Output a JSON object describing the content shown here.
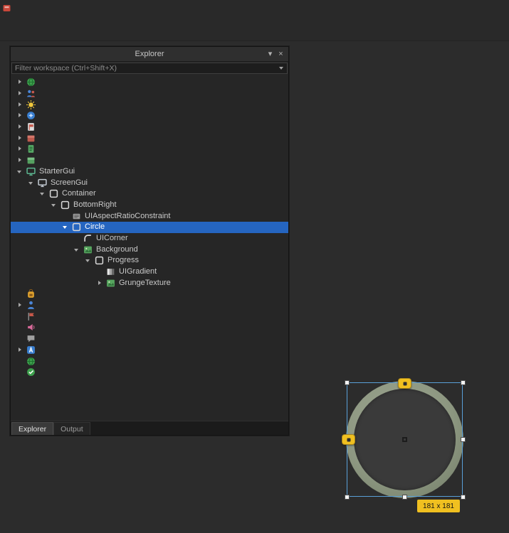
{
  "app": {
    "top_left_icon": "red-app-icon"
  },
  "explorer": {
    "title": "Explorer",
    "titlebar": {
      "chevron_glyph": "▾",
      "close_glyph": "×"
    },
    "filter_placeholder": "Filter workspace (Ctrl+Shift+X)",
    "tabs": [
      {
        "label": "Explorer",
        "active": true
      },
      {
        "label": "Output",
        "active": false
      }
    ],
    "tree": {
      "items": [
        {
          "label": "",
          "icon": "globe-icon",
          "level": 0,
          "state": "collapsed"
        },
        {
          "label": "",
          "icon": "people-icon",
          "level": 0,
          "state": "collapsed"
        },
        {
          "label": "",
          "icon": "sun-icon",
          "level": 0,
          "state": "collapsed"
        },
        {
          "label": "",
          "icon": "blue-sphere-icon",
          "level": 0,
          "state": "collapsed"
        },
        {
          "label": "",
          "icon": "document-flag-icon",
          "level": 0,
          "state": "collapsed"
        },
        {
          "label": "",
          "icon": "red-box-icon",
          "level": 0,
          "state": "collapsed"
        },
        {
          "label": "",
          "icon": "green-document-icon",
          "level": 0,
          "state": "collapsed"
        },
        {
          "label": "",
          "icon": "green-box-icon",
          "level": 0,
          "state": "collapsed"
        },
        {
          "label": "StarterGui",
          "icon": "monitor-icon",
          "level": 0,
          "state": "expanded"
        },
        {
          "label": "ScreenGui",
          "icon": "monitor-icon",
          "level": 1,
          "state": "expanded"
        },
        {
          "label": "Container",
          "icon": "frame-icon",
          "level": 2,
          "state": "expanded"
        },
        {
          "label": "BottomRight",
          "icon": "frame-icon",
          "level": 3,
          "state": "expanded"
        },
        {
          "label": "UIAspectRatioConstraint",
          "icon": "constraint-icon",
          "level": 4,
          "state": "leaf"
        },
        {
          "label": "Circle",
          "icon": "frame-icon",
          "level": 4,
          "state": "expanded",
          "selected": true
        },
        {
          "label": "UICorner",
          "icon": "corner-icon",
          "level": 5,
          "state": "leaf"
        },
        {
          "label": "Background",
          "icon": "image-icon",
          "level": 5,
          "state": "expanded"
        },
        {
          "label": "Progress",
          "icon": "frame-icon",
          "level": 6,
          "state": "expanded"
        },
        {
          "label": "UIGradient",
          "icon": "gradient-icon",
          "level": 7,
          "state": "leaf"
        },
        {
          "label": "GrungeTexture",
          "icon": "image-icon",
          "level": 7,
          "state": "collapsed"
        },
        {
          "label": "",
          "icon": "backpack-icon",
          "level": 0,
          "state": "leaf"
        },
        {
          "label": "",
          "icon": "person-icon",
          "level": 0,
          "state": "collapsed"
        },
        {
          "label": "",
          "icon": "flag-icon",
          "level": 0,
          "state": "leaf"
        },
        {
          "label": "",
          "icon": "speaker-icon",
          "level": 0,
          "state": "leaf"
        },
        {
          "label": "",
          "icon": "chat-icon",
          "level": 0,
          "state": "leaf"
        },
        {
          "label": "",
          "icon": "letter-a-icon",
          "level": 0,
          "state": "collapsed"
        },
        {
          "label": "",
          "icon": "globe-icon",
          "level": 0,
          "state": "leaf"
        },
        {
          "label": "",
          "icon": "check-icon",
          "level": 0,
          "state": "leaf"
        }
      ]
    }
  },
  "viewport": {
    "size_badge": "181 x 181",
    "selection_outline_color": "#5aa0d8",
    "handle_yellow": "#f0c020",
    "ring_color": "#8d9781",
    "inner_circle_color": "#3a3a3a"
  },
  "colors": {
    "background": "#2c2c2c",
    "panel_background": "#262626",
    "selection_highlight": "#2565c0",
    "badge_yellow": "#f0c020"
  }
}
